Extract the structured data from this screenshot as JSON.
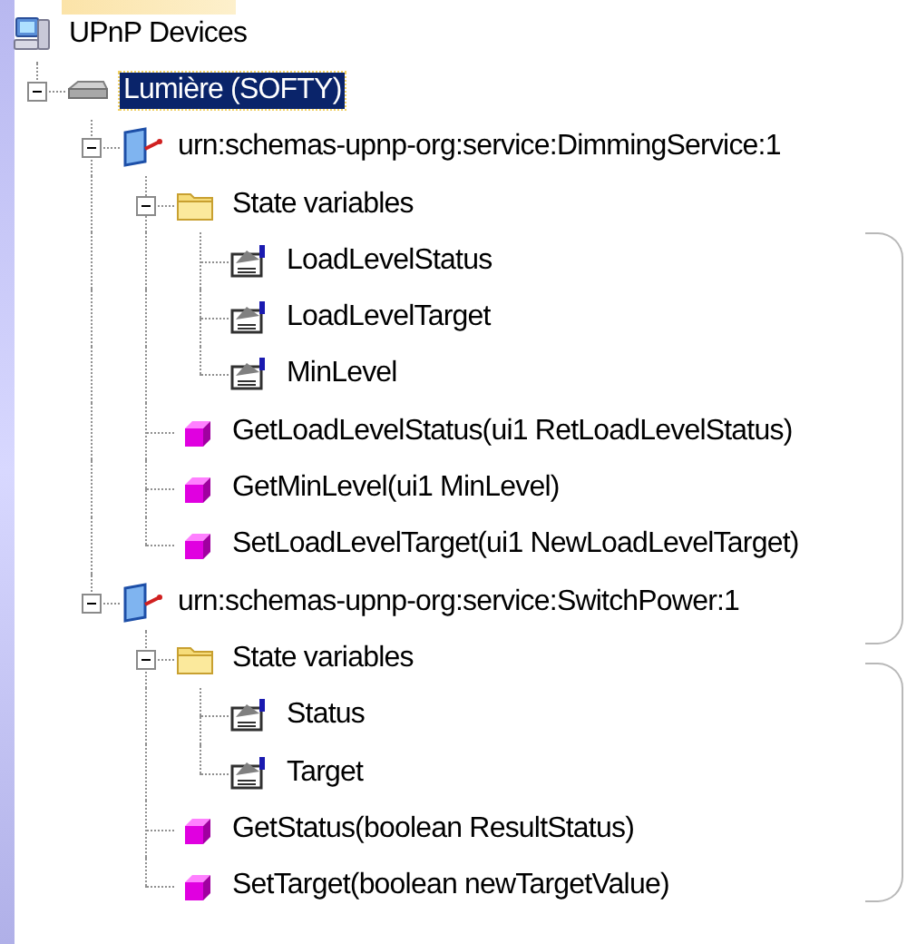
{
  "tree": {
    "label": "UPnP Devices",
    "kind": "root",
    "selected": false,
    "children": [
      {
        "label": "Lumière (SOFTY)",
        "kind": "device",
        "selected": true,
        "expanded": true,
        "children": [
          {
            "label": "urn:schemas-upnp-org:service:DimmingService:1",
            "kind": "service",
            "selected": false,
            "expanded": true,
            "children": [
              {
                "label": "State variables",
                "kind": "folder",
                "selected": false,
                "expanded": true,
                "children": [
                  {
                    "label": "LoadLevelStatus",
                    "kind": "variable",
                    "selected": false
                  },
                  {
                    "label": "LoadLevelTarget",
                    "kind": "variable",
                    "selected": false
                  },
                  {
                    "label": "MinLevel",
                    "kind": "variable",
                    "selected": false
                  }
                ]
              },
              {
                "label": "GetLoadLevelStatus(ui1 RetLoadLevelStatus)",
                "kind": "action",
                "selected": false
              },
              {
                "label": "GetMinLevel(ui1 MinLevel)",
                "kind": "action",
                "selected": false
              },
              {
                "label": "SetLoadLevelTarget(ui1 NewLoadLevelTarget)",
                "kind": "action",
                "selected": false
              }
            ]
          },
          {
            "label": "urn:schemas-upnp-org:service:SwitchPower:1",
            "kind": "service",
            "selected": false,
            "expanded": true,
            "children": [
              {
                "label": "State variables",
                "kind": "folder",
                "selected": false,
                "expanded": true,
                "children": [
                  {
                    "label": "Status",
                    "kind": "variable",
                    "selected": false
                  },
                  {
                    "label": "Target",
                    "kind": "variable",
                    "selected": false
                  }
                ]
              },
              {
                "label": "GetStatus(boolean ResultStatus)",
                "kind": "action",
                "selected": false
              },
              {
                "label": "SetTarget(boolean newTargetValue)",
                "kind": "action",
                "selected": false
              }
            ]
          }
        ]
      }
    ]
  }
}
